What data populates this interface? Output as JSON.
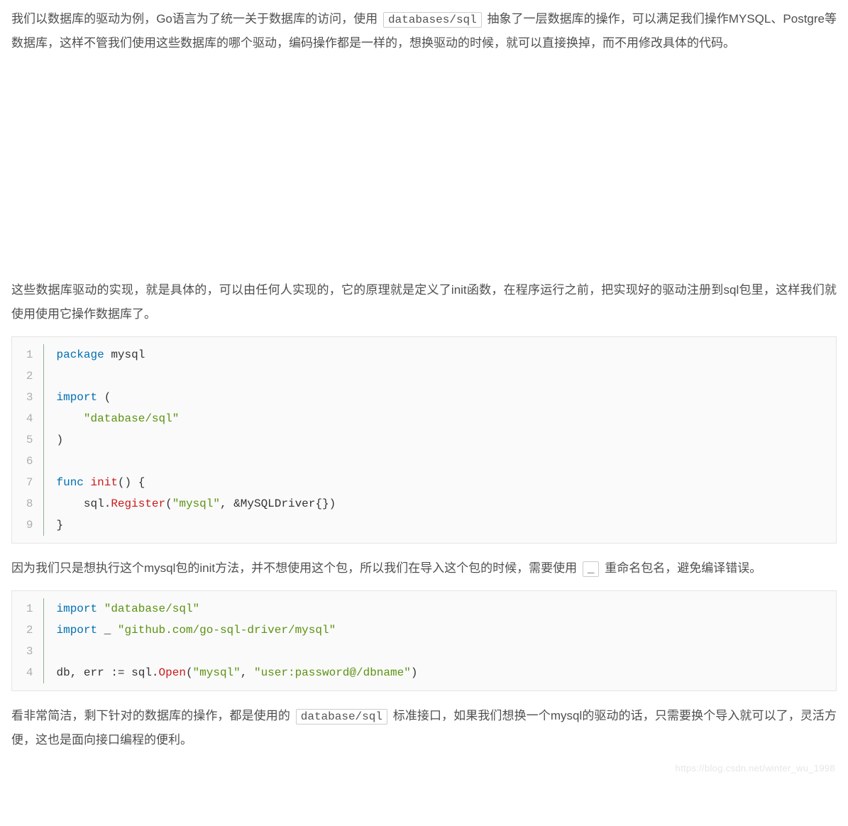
{
  "para1": {
    "t1": "我们以数据库的驱动为例，Go语言为了统一关于数据库的访问，使用 ",
    "code": "databases/sql",
    "t2": " 抽象了一层数据库的操作，可以满足我们操作MYSQL、Postgre等数据库，这样不管我们使用这些数据库的哪个驱动，编码操作都是一样的，想换驱动的时候，就可以直接换掉，而不用修改具体的代码。"
  },
  "para2": "这些数据库驱动的实现，就是具体的，可以由任何人实现的，它的原理就是定义了init函数，在程序运行之前，把实现好的驱动注册到sql包里，这样我们就使用使用它操作数据库了。",
  "code1": {
    "nums": [
      "1",
      "2",
      "3",
      "4",
      "5",
      "6",
      "7",
      "8",
      "9"
    ],
    "lines": [
      [
        {
          "c": "kw",
          "t": "package"
        },
        {
          "c": "plain",
          "t": " mysql"
        }
      ],
      [
        {
          "c": "plain",
          "t": ""
        }
      ],
      [
        {
          "c": "kw",
          "t": "import"
        },
        {
          "c": "plain",
          "t": " ("
        }
      ],
      [
        {
          "c": "plain",
          "t": "    "
        },
        {
          "c": "str",
          "t": "\"database/sql\""
        }
      ],
      [
        {
          "c": "plain",
          "t": ")"
        }
      ],
      [
        {
          "c": "plain",
          "t": ""
        }
      ],
      [
        {
          "c": "kw",
          "t": "func"
        },
        {
          "c": "plain",
          "t": " "
        },
        {
          "c": "fn",
          "t": "init"
        },
        {
          "c": "plain",
          "t": "() {"
        }
      ],
      [
        {
          "c": "plain",
          "t": "    sql."
        },
        {
          "c": "fn",
          "t": "Register"
        },
        {
          "c": "plain",
          "t": "("
        },
        {
          "c": "str",
          "t": "\"mysql\""
        },
        {
          "c": "plain",
          "t": ", &MySQLDriver{})"
        }
      ],
      [
        {
          "c": "plain",
          "t": "}"
        }
      ]
    ]
  },
  "para3": {
    "t1": "因为我们只是想执行这个mysql包的init方法，并不想使用这个包，所以我们在导入这个包的时候，需要使用 ",
    "code": "_",
    "t2": " 重命名包名，避免编译错误。"
  },
  "code2": {
    "nums": [
      "1",
      "2",
      "3",
      "4"
    ],
    "lines": [
      [
        {
          "c": "kw",
          "t": "import"
        },
        {
          "c": "plain",
          "t": " "
        },
        {
          "c": "str",
          "t": "\"database/sql\""
        }
      ],
      [
        {
          "c": "kw",
          "t": "import"
        },
        {
          "c": "plain",
          "t": " _ "
        },
        {
          "c": "str",
          "t": "\"github.com/go-sql-driver/mysql\""
        }
      ],
      [
        {
          "c": "plain",
          "t": ""
        }
      ],
      [
        {
          "c": "plain",
          "t": "db, err := sql."
        },
        {
          "c": "fn",
          "t": "Open"
        },
        {
          "c": "plain",
          "t": "("
        },
        {
          "c": "str",
          "t": "\"mysql\""
        },
        {
          "c": "plain",
          "t": ", "
        },
        {
          "c": "str",
          "t": "\"user:password@/dbname\""
        },
        {
          "c": "plain",
          "t": ")"
        }
      ]
    ]
  },
  "para4": {
    "t1": "看非常简洁，剩下针对的数据库的操作，都是使用的 ",
    "code": "database/sql",
    "t2": " 标准接口，如果我们想换一个mysql的驱动的话，只需要换个导入就可以了，灵活方便，这也是面向接口编程的便利。"
  },
  "watermark": "https://blog.csdn.net/winter_wu_1998"
}
